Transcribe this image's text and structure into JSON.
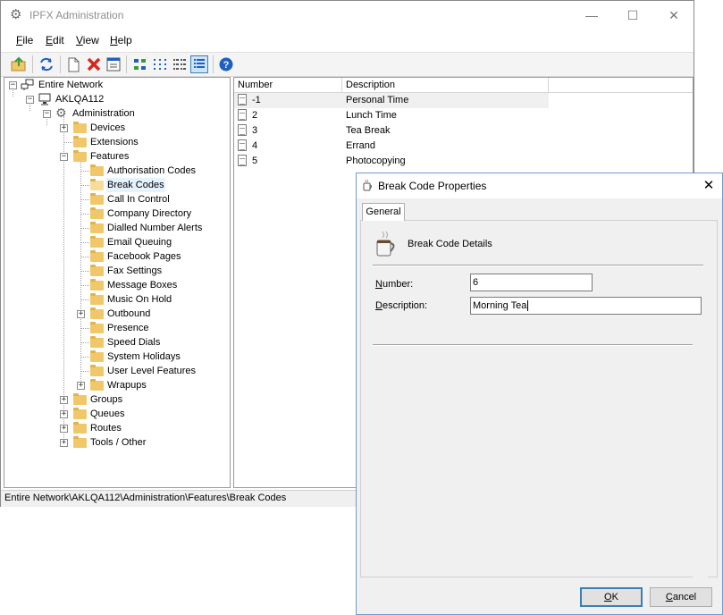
{
  "window": {
    "title": "IPFX Administration",
    "minimize": "—",
    "maximize": "☐",
    "close": "✕"
  },
  "menu": [
    {
      "label": "File",
      "accel": "F",
      "rest": "ile"
    },
    {
      "label": "Edit",
      "accel": "E",
      "rest": "dit"
    },
    {
      "label": "View",
      "accel": "V",
      "rest": "iew"
    },
    {
      "label": "Help",
      "accel": "H",
      "rest": "elp"
    }
  ],
  "toolbar": {
    "icons": [
      "up-folder-icon",
      "refresh-icon",
      "new-icon",
      "delete-icon",
      "properties-icon",
      "large-icons-icon",
      "small-icons-icon",
      "list-icon",
      "details-icon",
      "help-icon"
    ],
    "accent_green": "#3a9b3a",
    "accent_red": "#d9261c",
    "accent_blue": "#1f5fbf"
  },
  "tree": {
    "root": "Entire Network",
    "server": "AKLQA112",
    "administration": "Administration",
    "top_level": [
      "Devices",
      "Extensions",
      "Features"
    ],
    "features": [
      "Authorisation Codes",
      "Break Codes",
      "Call In Control",
      "Company Directory",
      "Dialled Number Alerts",
      "Email Queuing",
      "Facebook Pages",
      "Fax Settings",
      "Message Boxes",
      "Music On Hold",
      "Outbound",
      "Presence",
      "Speed Dials",
      "System Holidays",
      "User Level Features",
      "Wrapups"
    ],
    "after": [
      "Groups",
      "Queues",
      "Routes",
      "Tools / Other"
    ],
    "selected": "Break Codes"
  },
  "list": {
    "columns": [
      "Number",
      "Description"
    ],
    "rows": [
      {
        "number": "-1",
        "description": "Personal Time"
      },
      {
        "number": "2",
        "description": "Lunch Time"
      },
      {
        "number": "3",
        "description": "Tea Break"
      },
      {
        "number": "4",
        "description": "Errand"
      },
      {
        "number": "5",
        "description": "Photocopying"
      }
    ]
  },
  "status": {
    "path": "Entire Network\\AKLQA112\\Administration\\Features\\Break Codes"
  },
  "dialog": {
    "title": "Break Code Properties",
    "close": "✕",
    "tab": "General",
    "section_title": "Break Code Details",
    "number_label_accel": "N",
    "number_label_rest": "umber:",
    "number_value": "6",
    "description_label_accel": "D",
    "description_label_rest": "escription:",
    "description_value": "Morning Tea",
    "ok_accel": "O",
    "ok_rest": "K",
    "cancel_accel": "C",
    "cancel_rest": "ancel"
  }
}
